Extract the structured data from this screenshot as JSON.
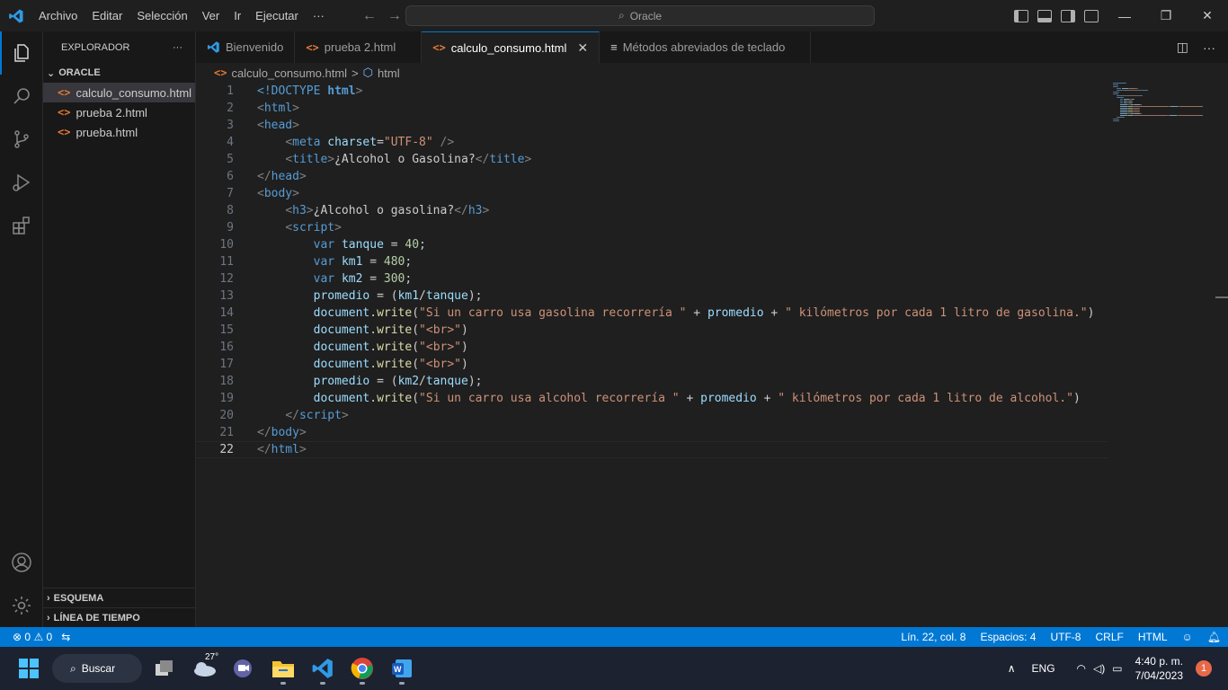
{
  "titlebar": {
    "menus": [
      "Archivo",
      "Editar",
      "Selección",
      "Ver",
      "Ir",
      "Ejecutar",
      "···"
    ],
    "command_center": "Oracle",
    "window_controls": [
      "minimize",
      "restore",
      "close"
    ]
  },
  "sidebar": {
    "title": "EXPLORADOR",
    "more": "···",
    "folder": "ORACLE",
    "files": [
      "calculo_consumo.html",
      "prueba 2.html",
      "prueba.html"
    ],
    "outline": "ESQUEMA",
    "timeline": "LÍNEA DE TIEMPO"
  },
  "tabs": [
    {
      "label": "Bienvenido",
      "icon": "vscode-icon"
    },
    {
      "label": "prueba 2.html",
      "icon": "html-icon"
    },
    {
      "label": "calculo_consumo.html",
      "icon": "html-icon"
    },
    {
      "label": "Métodos abreviados de teclado",
      "icon": "keyboard-shortcuts-icon"
    }
  ],
  "breadcrumb": {
    "file": "calculo_consumo.html",
    "sep": ">",
    "symbol": "html"
  },
  "editor": {
    "current_line": 22,
    "lines": [
      [
        [
          "<!DOCTYPE ",
          "tag"
        ],
        [
          "html",
          "tag"
        ],
        [
          ">",
          "pun"
        ]
      ],
      [
        [
          "<",
          "pun"
        ],
        [
          "html",
          "tag"
        ],
        [
          ">",
          "pun"
        ]
      ],
      [
        [
          "<",
          "pun"
        ],
        [
          "head",
          "tag"
        ],
        [
          ">",
          "pun"
        ]
      ],
      [
        [
          "    ",
          "txt"
        ],
        [
          "<",
          "pun"
        ],
        [
          "meta",
          "tag"
        ],
        [
          " ",
          "txt"
        ],
        [
          "charset",
          "attr"
        ],
        [
          "=",
          "txt"
        ],
        [
          "\"UTF-8\"",
          "str"
        ],
        [
          " />",
          "pun"
        ]
      ],
      [
        [
          "    ",
          "txt"
        ],
        [
          "<",
          "pun"
        ],
        [
          "title",
          "tag"
        ],
        [
          ">",
          "pun"
        ],
        [
          "¿Alcohol o Gasolina?",
          "txt"
        ],
        [
          "</",
          "pun"
        ],
        [
          "title",
          "tag"
        ],
        [
          ">",
          "pun"
        ]
      ],
      [
        [
          "</",
          "pun"
        ],
        [
          "head",
          "tag"
        ],
        [
          ">",
          "pun"
        ]
      ],
      [
        [
          "<",
          "pun"
        ],
        [
          "body",
          "tag"
        ],
        [
          ">",
          "pun"
        ]
      ],
      [
        [
          "    ",
          "txt"
        ],
        [
          "<",
          "pun"
        ],
        [
          "h3",
          "tag"
        ],
        [
          ">",
          "pun"
        ],
        [
          "¿Alcohol o gasolina?",
          "txt"
        ],
        [
          "</",
          "pun"
        ],
        [
          "h3",
          "tag"
        ],
        [
          ">",
          "pun"
        ]
      ],
      [
        [
          "    ",
          "txt"
        ],
        [
          "<",
          "pun"
        ],
        [
          "script",
          "tag"
        ],
        [
          ">",
          "pun"
        ]
      ],
      [
        [
          "        ",
          "txt"
        ],
        [
          "var",
          "kw"
        ],
        [
          " ",
          "txt"
        ],
        [
          "tanque",
          "var"
        ],
        [
          " = ",
          "txt"
        ],
        [
          "40",
          "num"
        ],
        [
          ";",
          "txt"
        ]
      ],
      [
        [
          "        ",
          "txt"
        ],
        [
          "var",
          "kw"
        ],
        [
          " ",
          "txt"
        ],
        [
          "km1",
          "var"
        ],
        [
          " = ",
          "txt"
        ],
        [
          "480",
          "num"
        ],
        [
          ";",
          "txt"
        ]
      ],
      [
        [
          "        ",
          "txt"
        ],
        [
          "var",
          "kw"
        ],
        [
          " ",
          "txt"
        ],
        [
          "km2",
          "var"
        ],
        [
          " = ",
          "txt"
        ],
        [
          "300",
          "num"
        ],
        [
          ";",
          "txt"
        ]
      ],
      [
        [
          "        ",
          "txt"
        ],
        [
          "promedio",
          "var"
        ],
        [
          " = (",
          "txt"
        ],
        [
          "km1",
          "var"
        ],
        [
          "/",
          "txt"
        ],
        [
          "tanque",
          "var"
        ],
        [
          ");",
          "txt"
        ]
      ],
      [
        [
          "        ",
          "txt"
        ],
        [
          "document",
          "var"
        ],
        [
          ".",
          "txt"
        ],
        [
          "write",
          "fn"
        ],
        [
          "(",
          "txt"
        ],
        [
          "\"Si un carro usa gasolina recorrería \"",
          "str"
        ],
        [
          " + ",
          "txt"
        ],
        [
          "promedio",
          "var"
        ],
        [
          " + ",
          "txt"
        ],
        [
          "\" kilómetros por cada 1 litro de gasolina.\"",
          "str"
        ],
        [
          ")",
          "txt"
        ]
      ],
      [
        [
          "        ",
          "txt"
        ],
        [
          "document",
          "var"
        ],
        [
          ".",
          "txt"
        ],
        [
          "write",
          "fn"
        ],
        [
          "(",
          "txt"
        ],
        [
          "\"<br>\"",
          "str"
        ],
        [
          ")",
          "txt"
        ]
      ],
      [
        [
          "        ",
          "txt"
        ],
        [
          "document",
          "var"
        ],
        [
          ".",
          "txt"
        ],
        [
          "write",
          "fn"
        ],
        [
          "(",
          "txt"
        ],
        [
          "\"<br>\"",
          "str"
        ],
        [
          ")",
          "txt"
        ]
      ],
      [
        [
          "        ",
          "txt"
        ],
        [
          "document",
          "var"
        ],
        [
          ".",
          "txt"
        ],
        [
          "write",
          "fn"
        ],
        [
          "(",
          "txt"
        ],
        [
          "\"<br>\"",
          "str"
        ],
        [
          ")",
          "txt"
        ]
      ],
      [
        [
          "        ",
          "txt"
        ],
        [
          "promedio",
          "var"
        ],
        [
          " = (",
          "txt"
        ],
        [
          "km2",
          "var"
        ],
        [
          "/",
          "txt"
        ],
        [
          "tanque",
          "var"
        ],
        [
          ");",
          "txt"
        ]
      ],
      [
        [
          "        ",
          "txt"
        ],
        [
          "document",
          "var"
        ],
        [
          ".",
          "txt"
        ],
        [
          "write",
          "fn"
        ],
        [
          "(",
          "txt"
        ],
        [
          "\"Si un carro usa alcohol recorrería \"",
          "str"
        ],
        [
          " + ",
          "txt"
        ],
        [
          "promedio",
          "var"
        ],
        [
          " + ",
          "txt"
        ],
        [
          "\" kilómetros por cada 1 litro de alcohol.\"",
          "str"
        ],
        [
          ")",
          "txt"
        ]
      ],
      [
        [
          "    ",
          "txt"
        ],
        [
          "</",
          "pun"
        ],
        [
          "script",
          "tag"
        ],
        [
          ">",
          "pun"
        ]
      ],
      [
        [
          "</",
          "pun"
        ],
        [
          "body",
          "tag"
        ],
        [
          ">",
          "pun"
        ]
      ],
      [
        [
          "</",
          "pun"
        ],
        [
          "html",
          "tag"
        ],
        [
          ">",
          "pun"
        ]
      ]
    ]
  },
  "statusbar": {
    "errors": "0",
    "warnings": "0",
    "position": "Lín. 22, col. 8",
    "spaces": "Espacios: 4",
    "encoding": "UTF-8",
    "eol": "CRLF",
    "language": "HTML"
  },
  "taskbar": {
    "search": "Buscar",
    "weather": "27°",
    "lang": "ENG",
    "time": "4:40 p. m.",
    "date": "7/04/2023",
    "notifications": "1"
  },
  "colors": {
    "accent": "#0078d4",
    "html_icon": "#e37933"
  }
}
